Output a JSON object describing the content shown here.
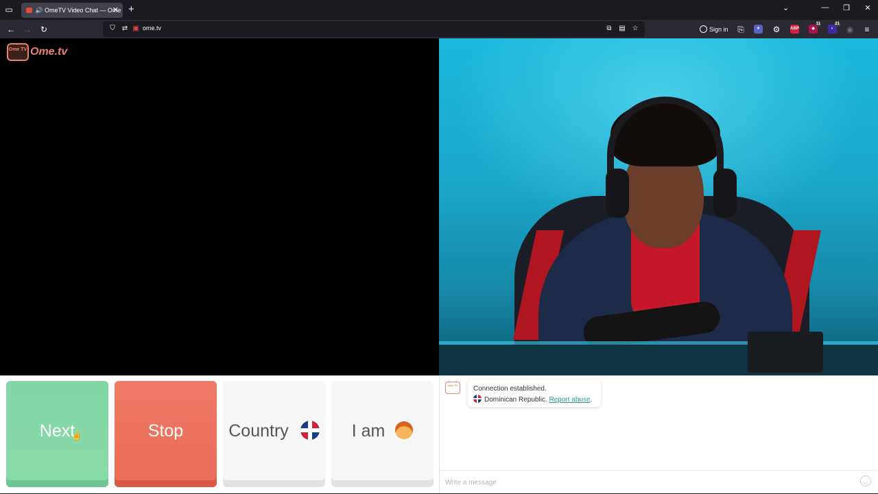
{
  "browser": {
    "tab_title": "OmeTV Video Chat — Ome",
    "url": "ome.tv",
    "sign_in_label": "Sign in",
    "ext_badges": [
      "11",
      "21"
    ]
  },
  "site": {
    "logo_text": "Ome.tv",
    "logo_badge": "Ome TV"
  },
  "controls": {
    "next_label": "Next",
    "stop_label": "Stop",
    "country_label": "Country",
    "i_am_label": "I am"
  },
  "chat": {
    "system_line1": "Connection established.",
    "country_text": "Dominican Republic.",
    "report_link": "Report abuse",
    "report_suffix": ".",
    "input_placeholder": "Write a message"
  },
  "colors": {
    "next": "#82d6a7",
    "stop": "#ef7a66",
    "brand": "#e8836f",
    "link": "#2b9a8b"
  }
}
